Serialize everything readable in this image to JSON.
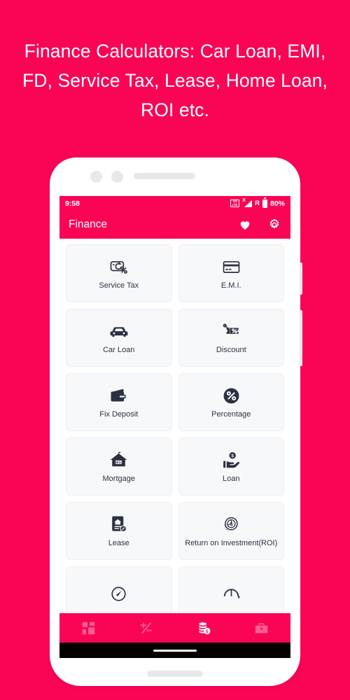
{
  "headline": "Finance Calculators: Car Loan, EMI, FD, Service Tax, Lease, Home Loan, ROI etc.",
  "colors": {
    "brand_pink": "#FA0556",
    "card_bg": "#F7F8FA",
    "icon_dark": "#2C3142",
    "text_white": "#FFFFFF"
  },
  "phone": {
    "status_bar": {
      "time": "9:58",
      "volte_line1": "VO",
      "volte_line2": "LTE",
      "signal_x": "X",
      "roaming": "R",
      "battery_percent": "80%"
    },
    "app_bar": {
      "title": "Finance",
      "actions": [
        {
          "name": "favorite-icon",
          "label": "Favorite"
        },
        {
          "name": "settings-gear-icon",
          "label": "Settings"
        }
      ]
    },
    "grid": [
      {
        "label": "Service Tax",
        "icon": "service-tax-icon"
      },
      {
        "label": "E.M.I.",
        "icon": "credit-card-icon"
      },
      {
        "label": "Car Loan",
        "icon": "car-icon"
      },
      {
        "label": "Discount",
        "icon": "discount-tag-icon"
      },
      {
        "label": "Fix Deposit",
        "icon": "wallet-icon"
      },
      {
        "label": "Percentage",
        "icon": "percent-circle-icon"
      },
      {
        "label": "Mortgage",
        "icon": "house-sell-icon"
      },
      {
        "label": "Loan",
        "icon": "hand-coin-icon"
      },
      {
        "label": "Lease",
        "icon": "lease-document-icon"
      },
      {
        "label": "Return on Investment(ROI)",
        "icon": "roi-coin-chart-icon"
      },
      {
        "label": "",
        "icon": "gauge-icon"
      },
      {
        "label": "",
        "icon": "speedometer-icon"
      }
    ],
    "bottom_nav": [
      {
        "name": "dashboard-grid-icon",
        "active": false
      },
      {
        "name": "plus-minus-math-icon",
        "active": false
      },
      {
        "name": "coins-stack-icon",
        "active": true
      },
      {
        "name": "briefcase-icon",
        "active": false
      }
    ]
  }
}
